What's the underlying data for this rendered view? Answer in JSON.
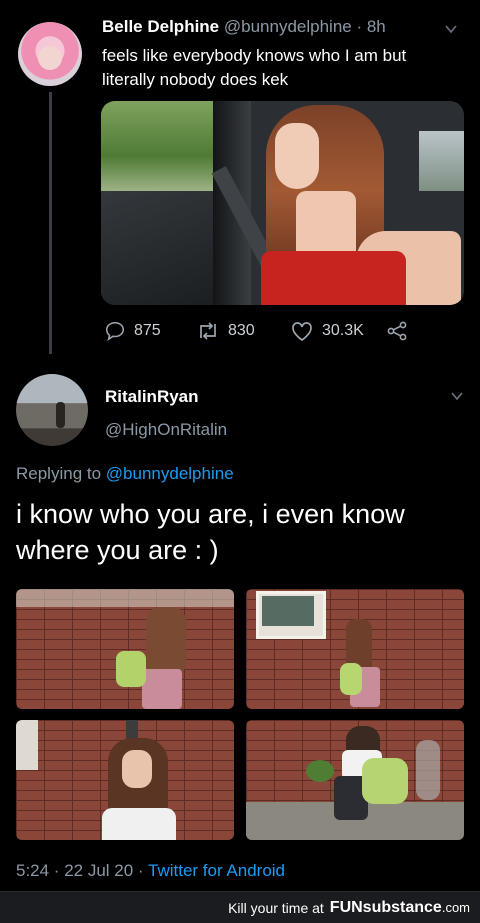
{
  "tweet1": {
    "author_name": "Belle Delphine",
    "author_handle": "@bunnydelphine",
    "time": "· 8h",
    "text": "feels like everybody knows who I am but literally nobody does kek",
    "replies": "875",
    "retweets": "830",
    "likes": "30.3K"
  },
  "tweet2": {
    "author_name": "RitalinRyan",
    "author_handle": "@HighOnRitalin",
    "replying_prefix": "Replying to",
    "replying_to": "@bunnydelphine",
    "text": "i know who you are, i even know where you are : )",
    "timestamp": "5:24 · 22 Jul 20 ·",
    "source": "Twitter for Android"
  },
  "watermark": {
    "tagline": "Kill your time at",
    "brand": "FUNsubstance",
    "domain": ".com"
  },
  "colors": {
    "background": "#000000",
    "muted": "#8b98a5",
    "link": "#1d9bf0"
  }
}
